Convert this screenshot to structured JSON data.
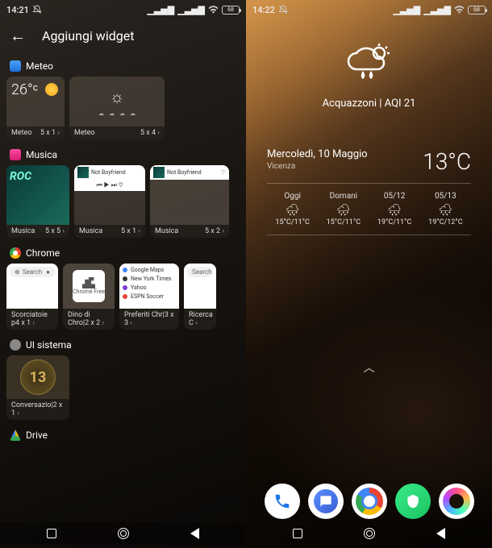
{
  "left": {
    "statusbar": {
      "time": "14:21",
      "battery": "68"
    },
    "header": {
      "title": "Aggiungi widget"
    },
    "sections": {
      "meteo": {
        "label": "Meteo",
        "w1": {
          "temp": "26°ᶜ",
          "name": "Meteo",
          "size": "5 x 1"
        },
        "w2": {
          "name": "Meteo",
          "size": "5 x 4"
        }
      },
      "musica": {
        "label": "Musica",
        "track": "Not Boyfriend",
        "w1": {
          "name": "Musica",
          "size": "5 x 5"
        },
        "w2": {
          "name": "Musica",
          "size": "5 x 1"
        },
        "w3": {
          "name": "Musica",
          "size": "5 x 2"
        }
      },
      "chrome": {
        "label": "Chrome",
        "search_pill": "Search",
        "dino_label": "Chrome Free",
        "bookmarks": {
          "b1": "Google Maps",
          "b2": "New York Times",
          "b3": "Yahoo",
          "b4": "ESPN Soccer"
        },
        "w1": {
          "name": "Scorciatoie p4 x 1"
        },
        "w2": {
          "name": "Dino di Chro|2 x 2"
        },
        "w3": {
          "name": "Preferiti Chr|3 x 3"
        },
        "w4": {
          "name": "Ricerca C",
          "search": "Search"
        }
      },
      "ui": {
        "label": "UI sistema",
        "badge": "13",
        "w1": {
          "name": "Conversazio|2 x 1"
        }
      },
      "drive": {
        "label": "Drive"
      }
    }
  },
  "right": {
    "statusbar": {
      "time": "14:22",
      "battery": "68"
    },
    "hero": {
      "label": "Acquazzoni | AQI 21"
    },
    "card": {
      "date": "Mercoledì, 10 Maggio",
      "location": "Vicenza",
      "temp": "13°C",
      "forecast": {
        "d1": {
          "day": "Oggi",
          "temps": "15°C/11°C"
        },
        "d2": {
          "day": "Domani",
          "temps": "15°C/11°C"
        },
        "d3": {
          "day": "05/12",
          "temps": "19°C/11°C"
        },
        "d4": {
          "day": "05/13",
          "temps": "19°C/12°C"
        }
      }
    }
  }
}
